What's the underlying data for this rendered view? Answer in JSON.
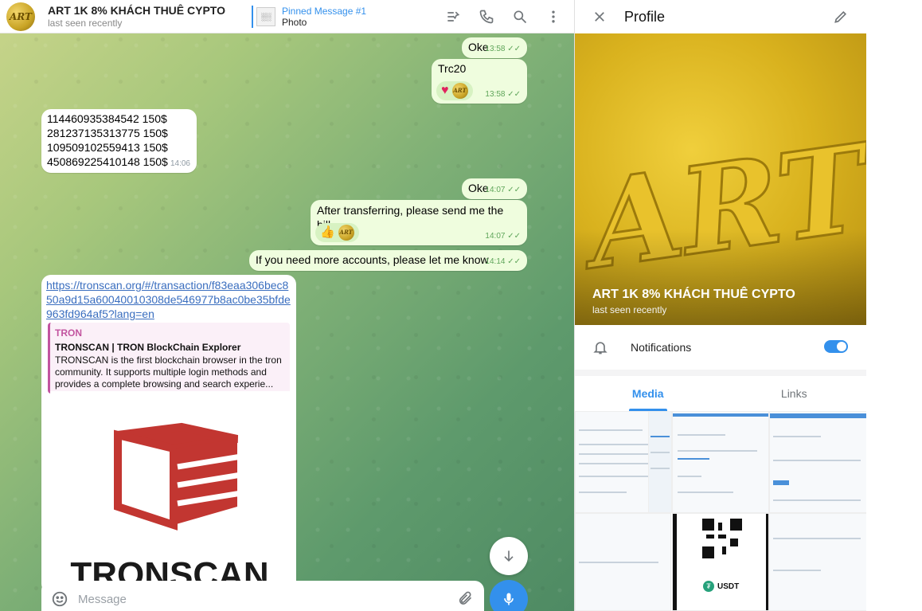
{
  "chat": {
    "title": "ART 1K 8% KHÁCH THUÊ CYPTO",
    "status": "last seen recently",
    "avatar_text": "ART",
    "pinned_title": "Pinned Message #1",
    "pinned_sub": "Photo",
    "pinned_thumb_text": "░░",
    "icons": [
      "pin-list-icon",
      "phone-icon",
      "search-icon",
      "more-vertical-icon"
    ]
  },
  "messages": [
    {
      "id": "m1",
      "dir": "out",
      "text": "Oke",
      "time": "13:58"
    },
    {
      "id": "m2",
      "dir": "out",
      "text": "Trc20",
      "time": "13:58",
      "reactions": [
        "heart",
        "art-coin"
      ]
    },
    {
      "id": "m3",
      "dir": "in",
      "lines": [
        "114460935384542 150$",
        "281237135313775 150$",
        "109509102559413 150$",
        "450869225410148 150$"
      ],
      "time": "14:06"
    },
    {
      "id": "m4",
      "dir": "out",
      "text": "Oke",
      "time": "14:07"
    },
    {
      "id": "m5",
      "dir": "out",
      "text": "After transferring, please send me the bill.",
      "time": "14:07",
      "reactions": [
        "thumbs-up",
        "art-coin"
      ]
    },
    {
      "id": "m6",
      "dir": "out",
      "text": "If you need more accounts, please let me know",
      "time": "14:14"
    },
    {
      "id": "m7",
      "dir": "in",
      "link": "https://tronscan.org/#/transaction/f83eaa306bec850a9d15a60040010308de546977b8ac0be35bfde963fd964af5?lang=en",
      "preview": {
        "site": "TRON",
        "title": "TRONSCAN | TRON BlockChain Explorer",
        "description": "TRONSCAN is the first blockchain browser in the tron community. It supports multiple login methods and provides a complete browsing and search experie...",
        "logo_text": "TRONSCAN"
      }
    }
  ],
  "composer": {
    "placeholder": "Message"
  },
  "profile": {
    "title": "Profile",
    "name": "ART 1K 8% KHÁCH THUÊ CYPTO",
    "status": "last seen recently",
    "cover_text": "ART",
    "notifications_label": "Notifications",
    "notifications_on": true,
    "tabs": [
      "Media",
      "Links"
    ],
    "active_tab": "Media",
    "media_labels": {
      "usdt": "USDT"
    }
  },
  "colors": {
    "accent": "#3390ec",
    "outgoing_bubble": "#effdde",
    "time_green": "#5fa55a",
    "tron_red": "#c23631"
  }
}
